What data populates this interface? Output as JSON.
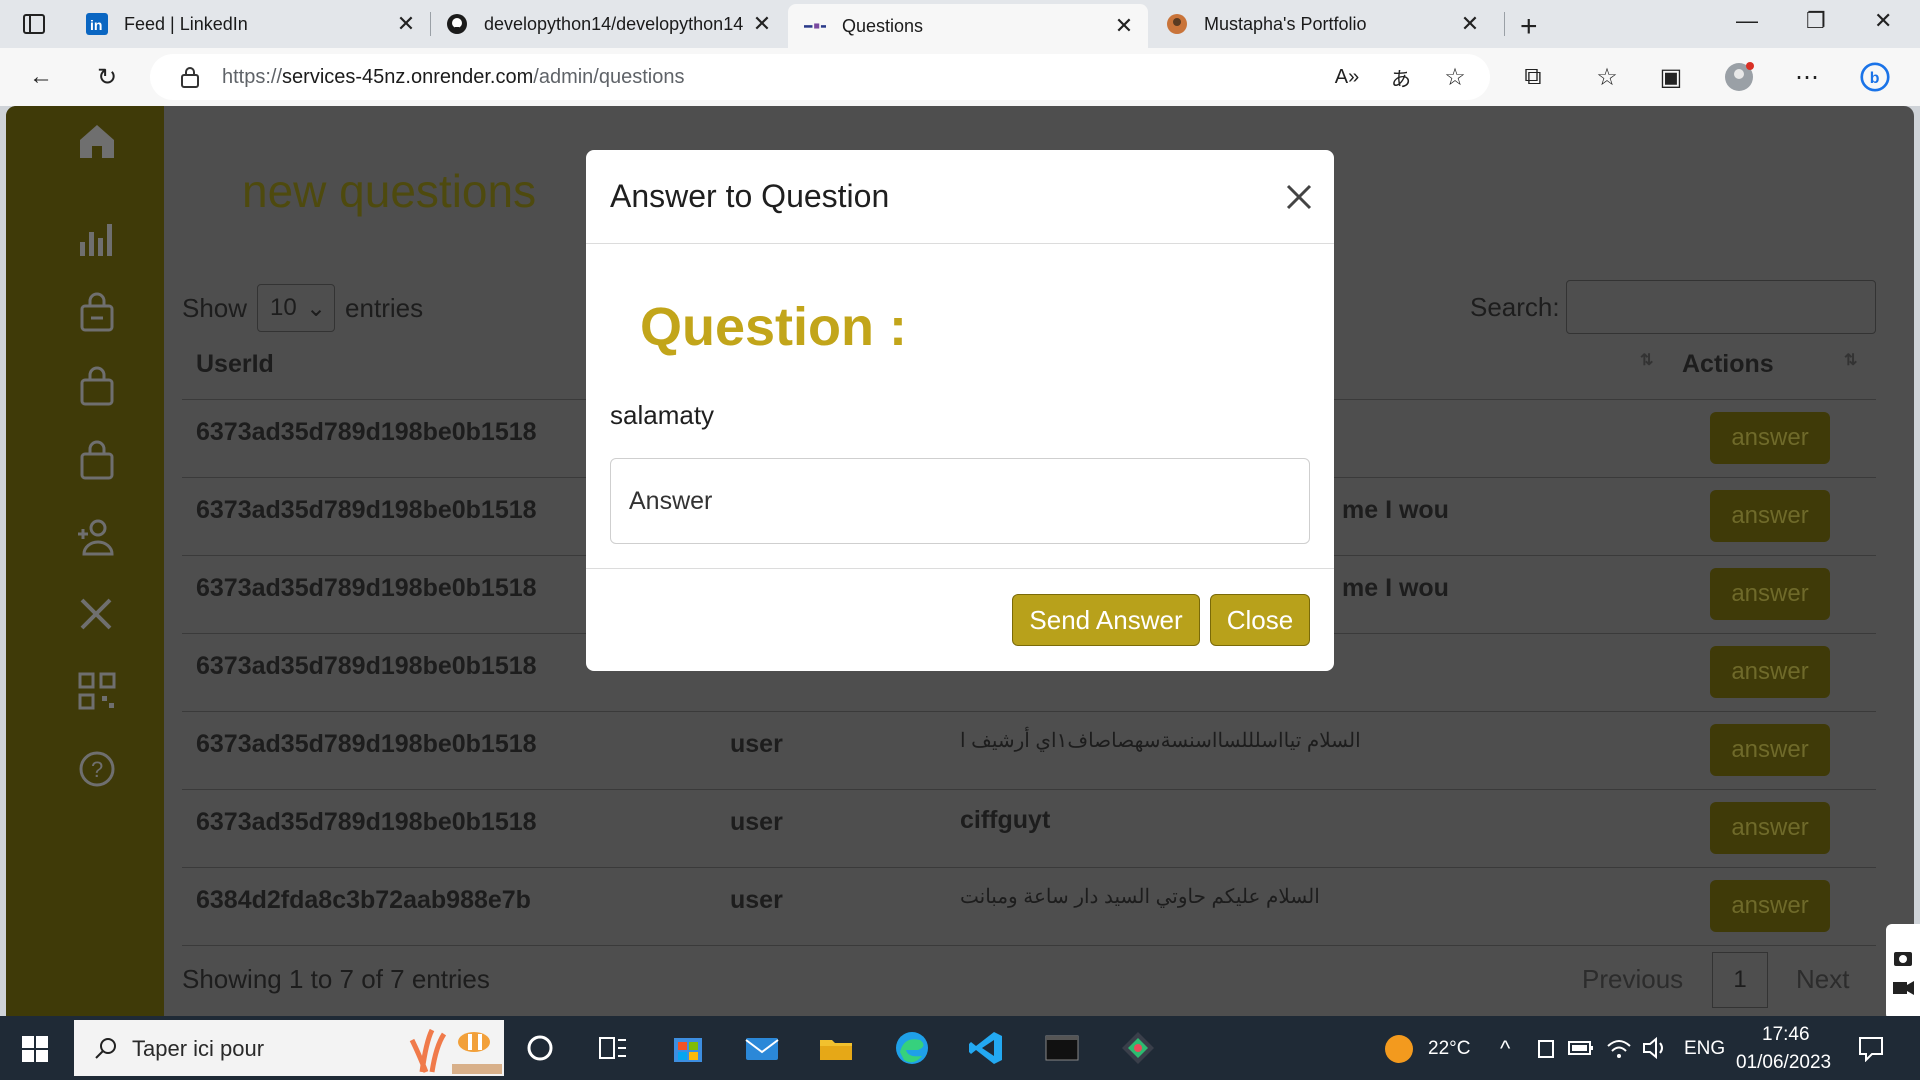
{
  "browser": {
    "tabs": [
      {
        "title": "Feed | LinkedIn",
        "icon": "linkedin-icon"
      },
      {
        "title": "developython14/developython14",
        "icon": "github-icon"
      },
      {
        "title": "Questions",
        "icon": "site-logo-icon"
      },
      {
        "title": "Mustapha's Portfolio",
        "icon": "portfolio-icon"
      }
    ],
    "url_scheme": "https://",
    "url_host": "services-45nz.onrender.com",
    "url_path": "/admin/questions"
  },
  "page": {
    "title": "new questions",
    "show_label": "Show",
    "entries_label": "entries",
    "page_size": "10",
    "search_label": "Search:",
    "columns": {
      "user_id": "UserId",
      "actions": "Actions"
    },
    "rows": [
      {
        "user_id": "6373ad35d789d198be0b1518",
        "role": "",
        "message": ""
      },
      {
        "user_id": "6373ad35d789d198be0b1518",
        "role": "",
        "message": "me I wou"
      },
      {
        "user_id": "6373ad35d789d198be0b1518",
        "role": "",
        "message": "me I wou"
      },
      {
        "user_id": "6373ad35d789d198be0b1518",
        "role": "",
        "message": ""
      },
      {
        "user_id": "6373ad35d789d198be0b1518",
        "role": "user",
        "message": "السلام تيااسلللسااسنسةسهصاصاف١اي أرشيف ا"
      },
      {
        "user_id": "6373ad35d789d198be0b1518",
        "role": "user",
        "message": "ciffguyt"
      },
      {
        "user_id": "6384d2fda8c3b72aab988e7b",
        "role": "user",
        "message": "السلام عليكم حاوتي السيد دار ساعة ومبانت"
      }
    ],
    "answer_label": "answer",
    "footer_info": "Showing 1 to 7 of 7 entries",
    "prev_label": "Previous",
    "page_number": "1",
    "next_label": "Next"
  },
  "modal": {
    "title": "Answer to Question",
    "question_heading": "Question :",
    "question_text": "salamaty",
    "answer_placeholder": "Answer",
    "send_label": "Send Answer",
    "close_label": "Close"
  },
  "taskbar": {
    "search_placeholder": "Taper ici pour",
    "temperature": "22°C",
    "language": "ENG",
    "time": "17:46",
    "date": "01/06/2023"
  },
  "colors": {
    "accent_gold": "#c2a51a",
    "button_gold": "#b8a11b",
    "sidebar_dim": "#3f3a08",
    "taskbar": "#1f2a36"
  }
}
